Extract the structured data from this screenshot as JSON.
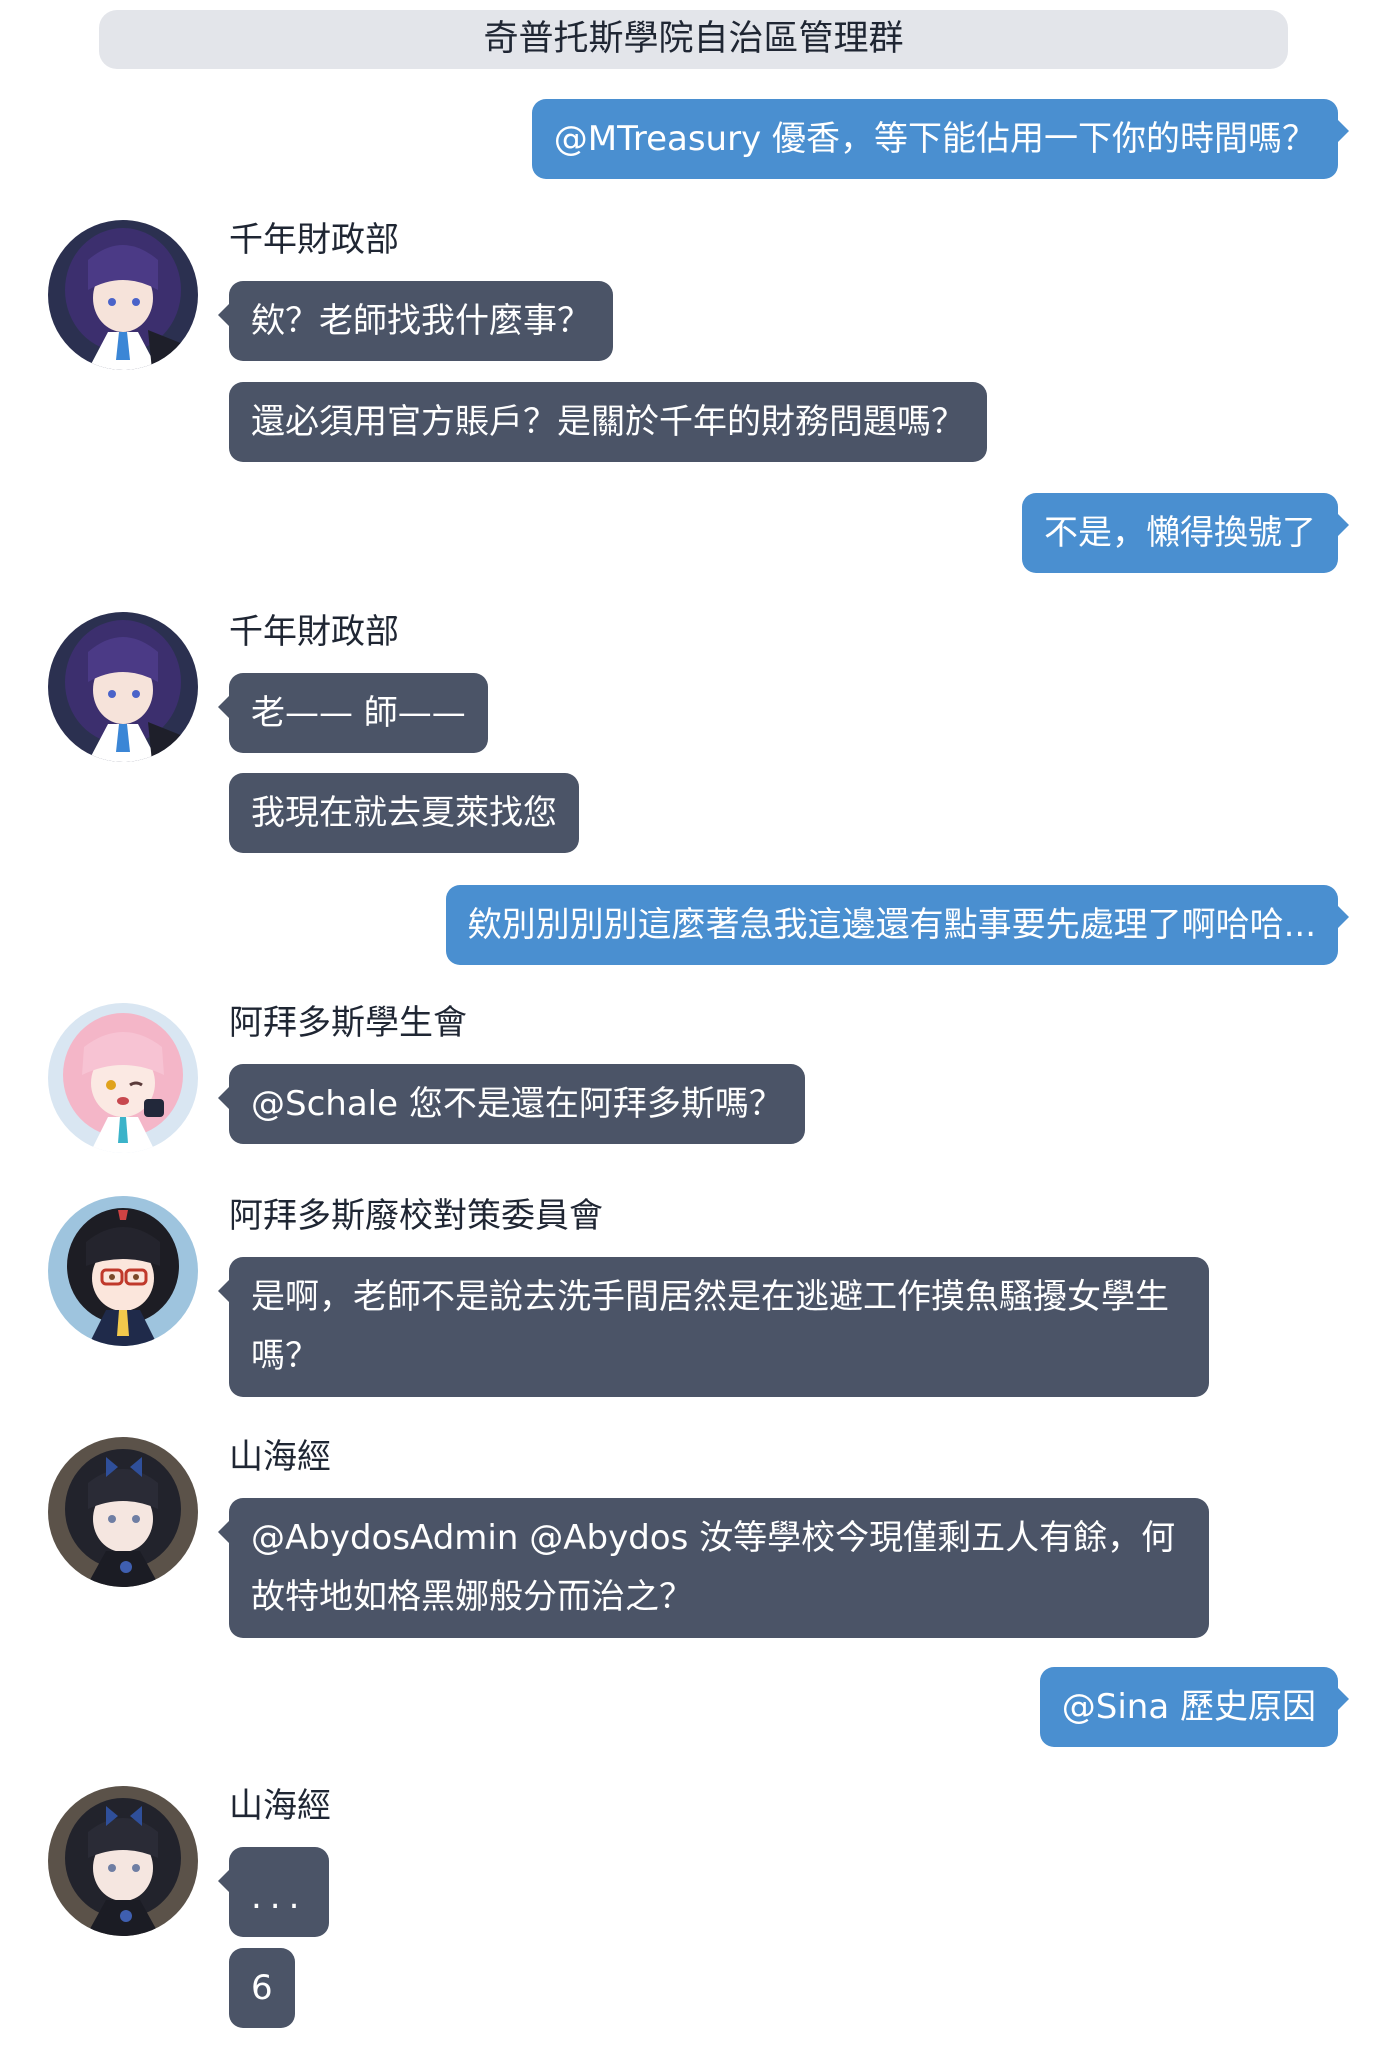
{
  "group": {
    "title": "奇普托斯學院自治區管理群"
  },
  "messages": {
    "m1": {
      "text": "@MTreasury 優香，等下能佔用一下你的時間嗎？"
    },
    "g1": {
      "sender": "千年財政部",
      "avatar_icon": "purple-hair-girl-avatar",
      "b1": "欸？老師找我什麼事？",
      "b2": "還必須用官方賬戶？是關於千年的財務問題嗎？"
    },
    "m2": {
      "text": "不是，懶得換號了"
    },
    "g2": {
      "sender": "千年財政部",
      "avatar_icon": "purple-hair-girl-avatar",
      "b1": "老—— 師——",
      "b2": "我現在就去夏萊找您"
    },
    "m3": {
      "text": "欸別別別別這麼著急我這邊還有點事要先處理了啊哈哈..."
    },
    "g3": {
      "sender": "阿拜多斯學生會",
      "avatar_icon": "pink-hair-girl-avatar",
      "b1": "@Schale 您不是還在阿拜多斯嗎？"
    },
    "g4": {
      "sender": "阿拜多斯廢校對策委員會",
      "avatar_icon": "black-hair-glasses-girl-avatar",
      "b1": "是啊，老師不是說去洗手間居然是在逃避工作摸魚騷擾女學生嗎？"
    },
    "g5": {
      "sender": "山海經",
      "avatar_icon": "dark-hair-butterfly-girl-avatar",
      "b1": "@AbydosAdmin @Abydos 汝等學校今現僅剩五人有餘，何故特地如格黑娜般分而治之？"
    },
    "m4": {
      "text": "@Sina 歷史原因"
    },
    "g6": {
      "sender": "山海經",
      "avatar_icon": "dark-hair-butterfly-girl-avatar",
      "b1": "...",
      "b2": "6"
    }
  },
  "colors": {
    "outgoing_bubble": "#4a8fd0",
    "incoming_bubble": "#4b5467",
    "title_bar": "#e3e5ea",
    "text_dark": "#1f2633"
  }
}
